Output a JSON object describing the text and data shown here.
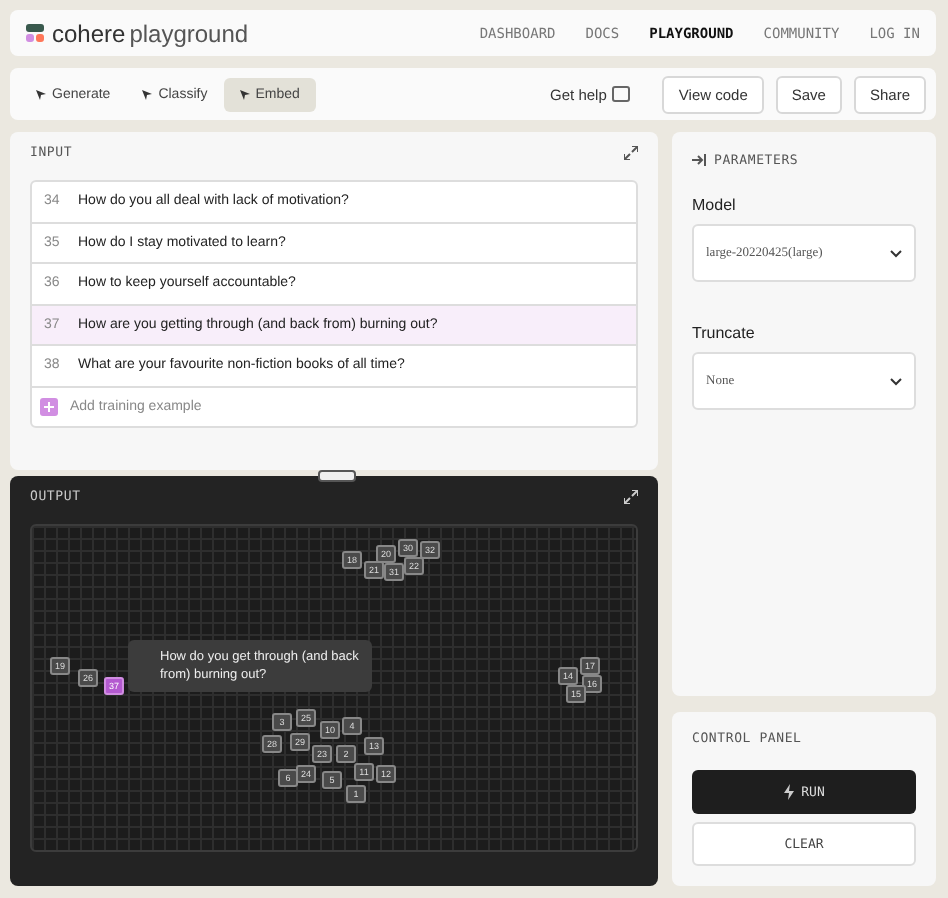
{
  "brand": {
    "name": "cohere",
    "product": "playground"
  },
  "nav": [
    {
      "label": "DASHBOARD",
      "selected": false
    },
    {
      "label": "DOCS",
      "selected": false
    },
    {
      "label": "PLAYGROUND",
      "selected": true
    },
    {
      "label": "COMMUNITY",
      "selected": false
    },
    {
      "label": "LOG IN",
      "selected": false
    }
  ],
  "modes": [
    {
      "label": "Generate",
      "selected": false
    },
    {
      "label": "Classify",
      "selected": false
    },
    {
      "label": "Embed",
      "selected": true
    }
  ],
  "help": "Get help",
  "actions": [
    "View code",
    "Save",
    "Share"
  ],
  "input": {
    "title": "INPUT",
    "examples": [
      {
        "number": "34",
        "text": "How do you all deal with lack of motivation?",
        "selected": false
      },
      {
        "number": "35",
        "text": "How do I stay motivated to learn?",
        "selected": false
      },
      {
        "number": "36",
        "text": "How to keep yourself accountable?",
        "selected": false
      },
      {
        "number": "37",
        "text": "How are you getting through (and back from) burning out?",
        "selected": true
      },
      {
        "number": "38",
        "text": "What are your favourite non-fiction books of all time?",
        "selected": false
      }
    ],
    "add": "Add training example"
  },
  "output": {
    "title": "OUTPUT",
    "points": [
      {
        "label": "18",
        "selected": false
      },
      {
        "label": "20",
        "selected": false
      },
      {
        "label": "30",
        "selected": false
      },
      {
        "label": "32",
        "selected": false
      },
      {
        "label": "21",
        "selected": false
      },
      {
        "label": "31",
        "selected": false
      },
      {
        "label": "22",
        "selected": false
      },
      {
        "label": "19",
        "selected": false
      },
      {
        "label": "26",
        "selected": false
      },
      {
        "label": "37",
        "selected": true
      },
      {
        "label": "14",
        "selected": false
      },
      {
        "label": "17",
        "selected": false
      },
      {
        "label": "16",
        "selected": false
      },
      {
        "label": "15",
        "selected": false
      },
      {
        "label": "3",
        "selected": false
      },
      {
        "label": "25",
        "selected": false
      },
      {
        "label": "10",
        "selected": false
      },
      {
        "label": "4",
        "selected": false
      },
      {
        "label": "28",
        "selected": false
      },
      {
        "label": "29",
        "selected": false
      },
      {
        "label": "23",
        "selected": false
      },
      {
        "label": "2",
        "selected": false
      },
      {
        "label": "13",
        "selected": false
      },
      {
        "label": "6",
        "selected": false
      },
      {
        "label": "24",
        "selected": false
      },
      {
        "label": "5",
        "selected": false
      },
      {
        "label": "11",
        "selected": false
      },
      {
        "label": "12",
        "selected": false
      },
      {
        "label": "1",
        "selected": false
      }
    ],
    "tooltip": "How do you get through (and back from) burning out?"
  },
  "parameters": {
    "title": "PARAMETERS",
    "fields": [
      {
        "label": "Model",
        "value": "large-20220425(large)"
      },
      {
        "label": "Truncate",
        "value": "None"
      }
    ]
  },
  "control_panel": {
    "title": "CONTROL PANEL",
    "run": "RUN",
    "clear": "CLEAR"
  }
}
